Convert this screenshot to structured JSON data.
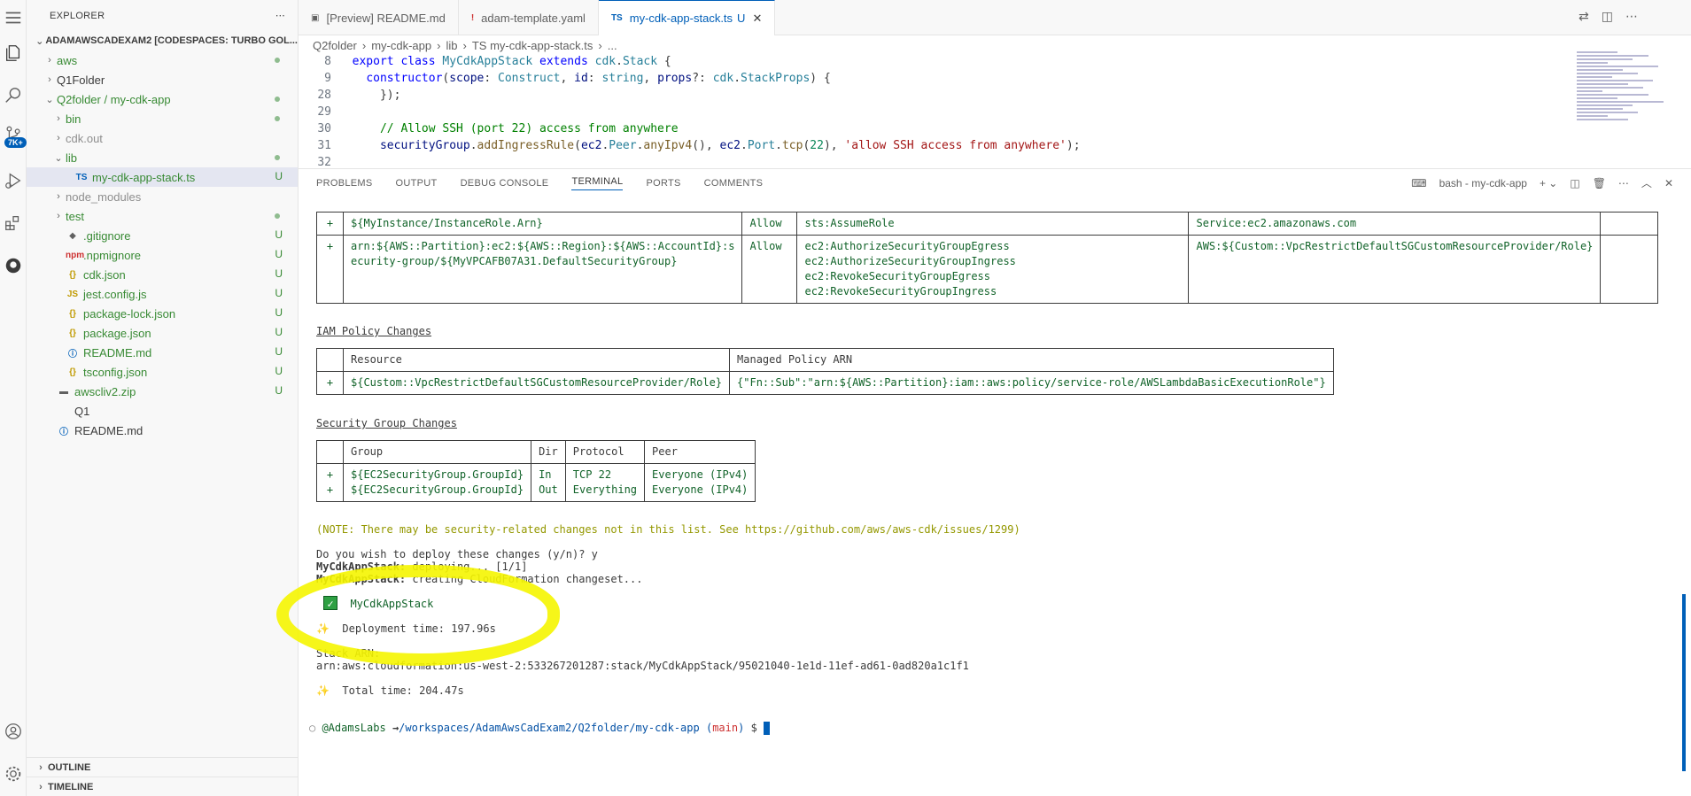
{
  "sidebar": {
    "title": "EXPLORER",
    "root": "ADAMAWSCADEXAM2 [CODESPACES: TURBO GOL...",
    "items": [
      {
        "label": "aws",
        "indent": 1,
        "type": "folder",
        "status": "dot"
      },
      {
        "label": "Q1Folder",
        "indent": 1,
        "type": "folder",
        "status": ""
      },
      {
        "label": "Q2folder / my-cdk-app",
        "indent": 1,
        "type": "folder-open",
        "status": "dot"
      },
      {
        "label": "bin",
        "indent": 2,
        "type": "folder",
        "status": "dot"
      },
      {
        "label": "cdk.out",
        "indent": 2,
        "type": "folder",
        "status": ""
      },
      {
        "label": "lib",
        "indent": 2,
        "type": "folder-open",
        "status": "dot"
      },
      {
        "label": "my-cdk-app-stack.ts",
        "indent": 3,
        "type": "ts",
        "status": "U"
      },
      {
        "label": "node_modules",
        "indent": 2,
        "type": "folder",
        "status": ""
      },
      {
        "label": "test",
        "indent": 2,
        "type": "folder",
        "status": "dot"
      },
      {
        "label": ".gitignore",
        "indent": 2,
        "type": "git",
        "status": "U"
      },
      {
        "label": ".npmignore",
        "indent": 2,
        "type": "npm",
        "status": "U"
      },
      {
        "label": "cdk.json",
        "indent": 2,
        "type": "json",
        "status": "U"
      },
      {
        "label": "jest.config.js",
        "indent": 2,
        "type": "js",
        "status": "U"
      },
      {
        "label": "package-lock.json",
        "indent": 2,
        "type": "json",
        "status": "U"
      },
      {
        "label": "package.json",
        "indent": 2,
        "type": "json",
        "status": "U"
      },
      {
        "label": "README.md",
        "indent": 2,
        "type": "info",
        "status": "U"
      },
      {
        "label": "tsconfig.json",
        "indent": 2,
        "type": "json",
        "status": "U"
      },
      {
        "label": "awscliv2.zip",
        "indent": 1,
        "type": "zip",
        "status": "U"
      },
      {
        "label": "Q1",
        "indent": 1,
        "type": "file",
        "status": ""
      },
      {
        "label": "README.md",
        "indent": 1,
        "type": "info",
        "status": ""
      }
    ],
    "outline": "OUTLINE",
    "timeline": "TIMELINE"
  },
  "activity": {
    "badge": "7K+"
  },
  "tabs": [
    {
      "label": "[Preview] README.md",
      "icon": "preview-icon",
      "active": false
    },
    {
      "label": "adam-template.yaml",
      "icon": "yaml-icon",
      "active": false
    },
    {
      "label": "my-cdk-app-stack.ts",
      "icon": "ts-icon",
      "active": true,
      "status": "U"
    }
  ],
  "breadcrumb": [
    "Q2folder",
    "my-cdk-app",
    "lib",
    "TS my-cdk-app-stack.ts",
    "..."
  ],
  "code": {
    "lines": [
      {
        "num": "8",
        "parts": [
          [
            "kw",
            "export "
          ],
          [
            "kw",
            "class "
          ],
          [
            "ty",
            "MyCdkAppStack "
          ],
          [
            "kw",
            "extends "
          ],
          [
            "ty",
            "cdk"
          ],
          [
            "",
            "."
          ],
          [
            "ty",
            "Stack"
          ],
          [
            "",
            " {"
          ]
        ]
      },
      {
        "num": "9",
        "parts": [
          [
            "",
            "  "
          ],
          [
            "kw",
            "constructor"
          ],
          [
            "",
            "("
          ],
          [
            "vr",
            "scope"
          ],
          [
            "",
            ": "
          ],
          [
            "ty",
            "Construct"
          ],
          [
            "",
            ", "
          ],
          [
            "vr",
            "id"
          ],
          [
            "",
            ": "
          ],
          [
            "ty",
            "string"
          ],
          [
            "",
            ", "
          ],
          [
            "vr",
            "props"
          ],
          [
            "",
            "?: "
          ],
          [
            "ty",
            "cdk"
          ],
          [
            "",
            "."
          ],
          [
            "ty",
            "StackProps"
          ],
          [
            "",
            ") {"
          ]
        ]
      },
      {
        "num": "28",
        "parts": [
          [
            "",
            "    });"
          ]
        ]
      },
      {
        "num": "29",
        "parts": [
          [
            "",
            ""
          ]
        ]
      },
      {
        "num": "30",
        "parts": [
          [
            "",
            "    "
          ],
          [
            "cm",
            "// Allow SSH (port 22) access from anywhere"
          ]
        ]
      },
      {
        "num": "31",
        "parts": [
          [
            "",
            "    "
          ],
          [
            "vr",
            "securityGroup"
          ],
          [
            "",
            "."
          ],
          [
            "fn",
            "addIngressRule"
          ],
          [
            "",
            "("
          ],
          [
            "vr",
            "ec2"
          ],
          [
            "",
            "."
          ],
          [
            "ty",
            "Peer"
          ],
          [
            "",
            "."
          ],
          [
            "fn",
            "anyIpv4"
          ],
          [
            "",
            "(), "
          ],
          [
            "vr",
            "ec2"
          ],
          [
            "",
            "."
          ],
          [
            "ty",
            "Port"
          ],
          [
            "",
            "."
          ],
          [
            "fn",
            "tcp"
          ],
          [
            "",
            "("
          ],
          [
            "nm",
            "22"
          ],
          [
            "",
            "), "
          ],
          [
            "st",
            "'allow SSH access from anywhere'"
          ],
          [
            "",
            ");"
          ]
        ]
      },
      {
        "num": "32",
        "parts": [
          [
            "",
            ""
          ]
        ]
      }
    ]
  },
  "panel": {
    "tabs": [
      "PROBLEMS",
      "OUTPUT",
      "DEBUG CONSOLE",
      "TERMINAL",
      "PORTS",
      "COMMENTS"
    ],
    "active_tab": "TERMINAL",
    "terminal_name": "bash - my-cdk-app"
  },
  "terminal": {
    "iam_statement_rows": [
      {
        "sign": "+",
        "resource": "${MyInstance/InstanceRole.Arn}",
        "effect": "Allow",
        "action": "sts:AssumeRole",
        "principal": "Service:ec2.amazonaws.com"
      },
      {
        "sign": "+",
        "resource": "arn:${AWS::Partition}:ec2:${AWS::Region}:${AWS::AccountId}:s\necurity-group/${MyVPCAFB07A31.DefaultSecurityGroup}",
        "effect": "Allow",
        "action": "ec2:AuthorizeSecurityGroupEgress\nec2:AuthorizeSecurityGroupIngress\nec2:RevokeSecurityGroupEgress\nec2:RevokeSecurityGroupIngress",
        "principal": "AWS:${Custom::VpcRestrictDefaultSGCustomResourceProvider/Role}"
      }
    ],
    "iam_policy_title": "IAM Policy Changes",
    "iam_policy_headers": [
      "Resource",
      "Managed Policy ARN"
    ],
    "iam_policy_row": {
      "sign": "+",
      "resource": "${Custom::VpcRestrictDefaultSGCustomResourceProvider/Role}",
      "arn": "{\"Fn::Sub\":\"arn:${AWS::Partition}:iam::aws:policy/service-role/AWSLambdaBasicExecutionRole\"}"
    },
    "sg_title": "Security Group Changes",
    "sg_headers": [
      "Group",
      "Dir",
      "Protocol",
      "Peer"
    ],
    "sg_row": {
      "sign": "+\n+",
      "group": "${EC2SecurityGroup.GroupId}\n${EC2SecurityGroup.GroupId}",
      "dir": "In\nOut",
      "protocol": "TCP 22\nEverything",
      "peer": "Everyone (IPv4)\nEveryone (IPv4)"
    },
    "note": "(NOTE: There may be security-related changes not in this list. See https://github.com/aws/aws-cdk/issues/1299)",
    "prompt": "Do you wish to deploy these changes (y/n)? y",
    "deploying_stack": "MyCdkAppStack:",
    "deploying_text": " deploying... [1/1]",
    "creating_stack": "MyCdkAppStack:",
    "creating_text": " creating CloudFormation changeset...",
    "success_stack": "MyCdkAppStack",
    "deploy_time": "Deployment time: 197.96s",
    "arn_label": "Stack ARN:",
    "arn_value": "arn:aws:cloudformation:us-west-2:533267201287:stack/MyCdkAppStack/95021040-1e1d-11ef-ad61-0ad820a1c1f1",
    "total_time": "Total time: 204.47s",
    "ps_user": "@AdamsLabs",
    "ps_arrow": "→",
    "ps_path": "/workspaces/AdamAwsCadExam2/Q2folder/my-cdk-app",
    "ps_branch_open": "(",
    "ps_branch": "main",
    "ps_branch_close": ")",
    "ps_dollar": "$"
  },
  "colors": {
    "accent": "#005fb8",
    "highlight": "#f5f500",
    "green": "#116329"
  }
}
